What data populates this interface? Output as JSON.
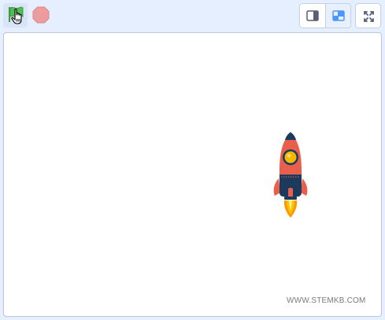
{
  "toolbar": {
    "green_flag_icon": "green-flag-icon",
    "stop_icon": "stop-sign-icon",
    "small_stage_icon": "small-stage-icon",
    "normal_stage_icon": "normal-stage-icon",
    "fullscreen_icon": "fullscreen-icon"
  },
  "stage": {
    "sprite": "rocket",
    "watermark": "WWW.STEMKB.COM"
  },
  "colors": {
    "toolbar_bg": "#e5efff",
    "stage_bg": "#ffffff",
    "flag_green": "#4cbf56",
    "stop_red": "#ec9c9c",
    "accent_blue": "#4c97ff",
    "rocket_body": "#e8604c",
    "rocket_navy": "#1c3a5c",
    "rocket_window": "#f5b800",
    "flame": "#ffc107"
  }
}
